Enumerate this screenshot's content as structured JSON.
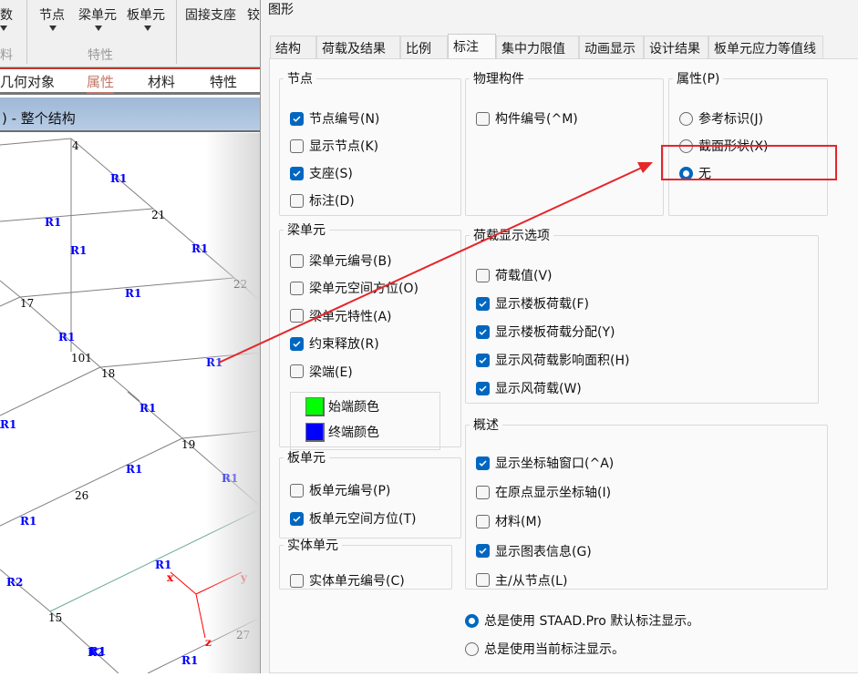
{
  "ribbon": {
    "items": [
      "数",
      "节点",
      "梁单元",
      "板单元",
      "固接支座",
      "铰"
    ],
    "groups": [
      "料",
      "特性"
    ]
  },
  "property_tabs": [
    "几何对象",
    "属性",
    "材料",
    "特性"
  ],
  "property_tab_active": "属性",
  "viewport_title": ") - 整个结构",
  "viewport": {
    "nodes": [
      "4",
      "21",
      "22",
      "17",
      "101",
      "18",
      "19",
      "26",
      "15",
      "27"
    ],
    "members": [
      "R1",
      "R1",
      "R1",
      "R1",
      "R1",
      "R1",
      "R1",
      "R1",
      "R1",
      "1",
      "R1",
      "R1",
      "R1",
      "R1",
      "R1",
      "R2",
      "R2",
      "R1"
    ],
    "axes": [
      "x",
      "y",
      "z"
    ],
    "colors": {
      "member_label": "#0000ff",
      "axis": "#ff0000",
      "arrow": "#e5262a"
    }
  },
  "dialog": {
    "title": "图形",
    "tabs": [
      "结构",
      "荷载及结果",
      "比例",
      "标注",
      "集中力限值",
      "动画显示",
      "设计结果",
      "板单元应力等值线"
    ],
    "active_tab": "标注",
    "groups": {
      "node": {
        "title": "节点",
        "items": [
          {
            "label": "节点编号(N)",
            "checked": true
          },
          {
            "label": "显示节点(K)",
            "checked": false
          },
          {
            "label": "支座(S)",
            "checked": true
          },
          {
            "label": "标注(D)",
            "checked": false
          }
        ]
      },
      "physical": {
        "title": "物理构件",
        "items": [
          {
            "label": "构件编号(^M)",
            "checked": false
          }
        ]
      },
      "property": {
        "title": "属性(P)",
        "items": [
          {
            "label": "参考标识(J)",
            "selected": false
          },
          {
            "label": "截面形状(X)",
            "selected": false
          },
          {
            "label": "无",
            "selected": true
          }
        ]
      },
      "beam": {
        "title": "梁单元",
        "items": [
          {
            "label": "梁单元编号(B)",
            "checked": false
          },
          {
            "label": "梁单元空间方位(O)",
            "checked": false
          },
          {
            "label": "梁单元特性(A)",
            "checked": false
          },
          {
            "label": "约束释放(R)",
            "checked": true
          },
          {
            "label": "梁端(E)",
            "checked": false
          }
        ],
        "colors": [
          {
            "label": "始端颜色",
            "color": "#00ff00"
          },
          {
            "label": "终端颜色",
            "color": "#0000ff"
          }
        ]
      },
      "plate": {
        "title": "板单元",
        "items": [
          {
            "label": "板单元编号(P)",
            "checked": false
          },
          {
            "label": "板单元空间方位(T)",
            "checked": true
          }
        ]
      },
      "solid": {
        "title": "实体单元",
        "items": [
          {
            "label": "实体单元编号(C)",
            "checked": false
          }
        ]
      },
      "load": {
        "title": "荷载显示选项",
        "items": [
          {
            "label": "荷载值(V)",
            "checked": false
          },
          {
            "label": "显示楼板荷载(F)",
            "checked": true
          },
          {
            "label": "显示楼板荷载分配(Y)",
            "checked": true
          },
          {
            "label": "显示风荷载影响面积(H)",
            "checked": true
          },
          {
            "label": "显示风荷载(W)",
            "checked": true
          }
        ]
      },
      "overview": {
        "title": "概述",
        "items": [
          {
            "label": "显示坐标轴窗口(^A)",
            "checked": true
          },
          {
            "label": "在原点显示坐标轴(I)",
            "checked": false
          },
          {
            "label": "材料(M)",
            "checked": false
          },
          {
            "label": "显示图表信息(G)",
            "checked": true
          },
          {
            "label": "主/从节点(L)",
            "checked": false
          }
        ]
      }
    },
    "display_mode": [
      {
        "label": "总是使用 STAAD.Pro 默认标注显示。",
        "selected": true
      },
      {
        "label": "总是使用当前标注显示。",
        "selected": false
      }
    ],
    "accent": "#0067c0"
  }
}
